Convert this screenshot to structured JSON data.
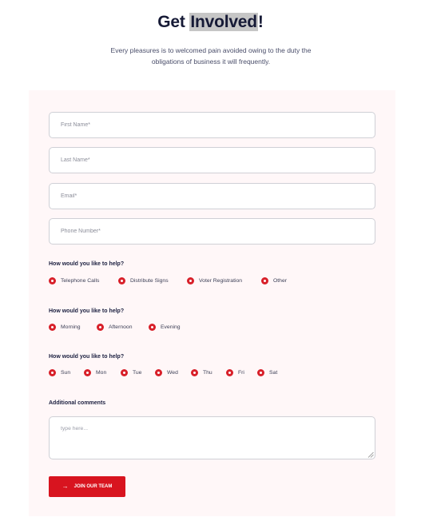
{
  "header": {
    "title_prefix": "Get ",
    "title_highlight": "Involved",
    "title_suffix": "!",
    "subtitle_line1": "Every pleasures is to welcomed pain avoided owing to the duty the",
    "subtitle_line2": "obligations of business it will frequently."
  },
  "form": {
    "first_name_placeholder": "First Name*",
    "last_name_placeholder": "Last Name*",
    "email_placeholder": "Email*",
    "phone_placeholder": "Phone Number*",
    "question1": {
      "label": "How would you like to help?",
      "options": [
        "Telephone Calls",
        "Distribute Signs",
        "Voter Registration",
        "Other"
      ]
    },
    "question2": {
      "label": "How would you like to help?",
      "options": [
        "Morning",
        "Afternoon",
        "Evening"
      ]
    },
    "question3": {
      "label": "How would you like to help?",
      "options": [
        "Sun",
        "Mon",
        "Tue",
        "Wed",
        "Thu",
        "Fri",
        "Sat"
      ]
    },
    "comments_label": "Additional comments",
    "comments_placeholder": "type here...",
    "submit_label": "JOIN OUR TEAM"
  },
  "colors": {
    "accent": "#d8202a",
    "panel_background": "#fff7f8",
    "heading": "#161a36"
  }
}
